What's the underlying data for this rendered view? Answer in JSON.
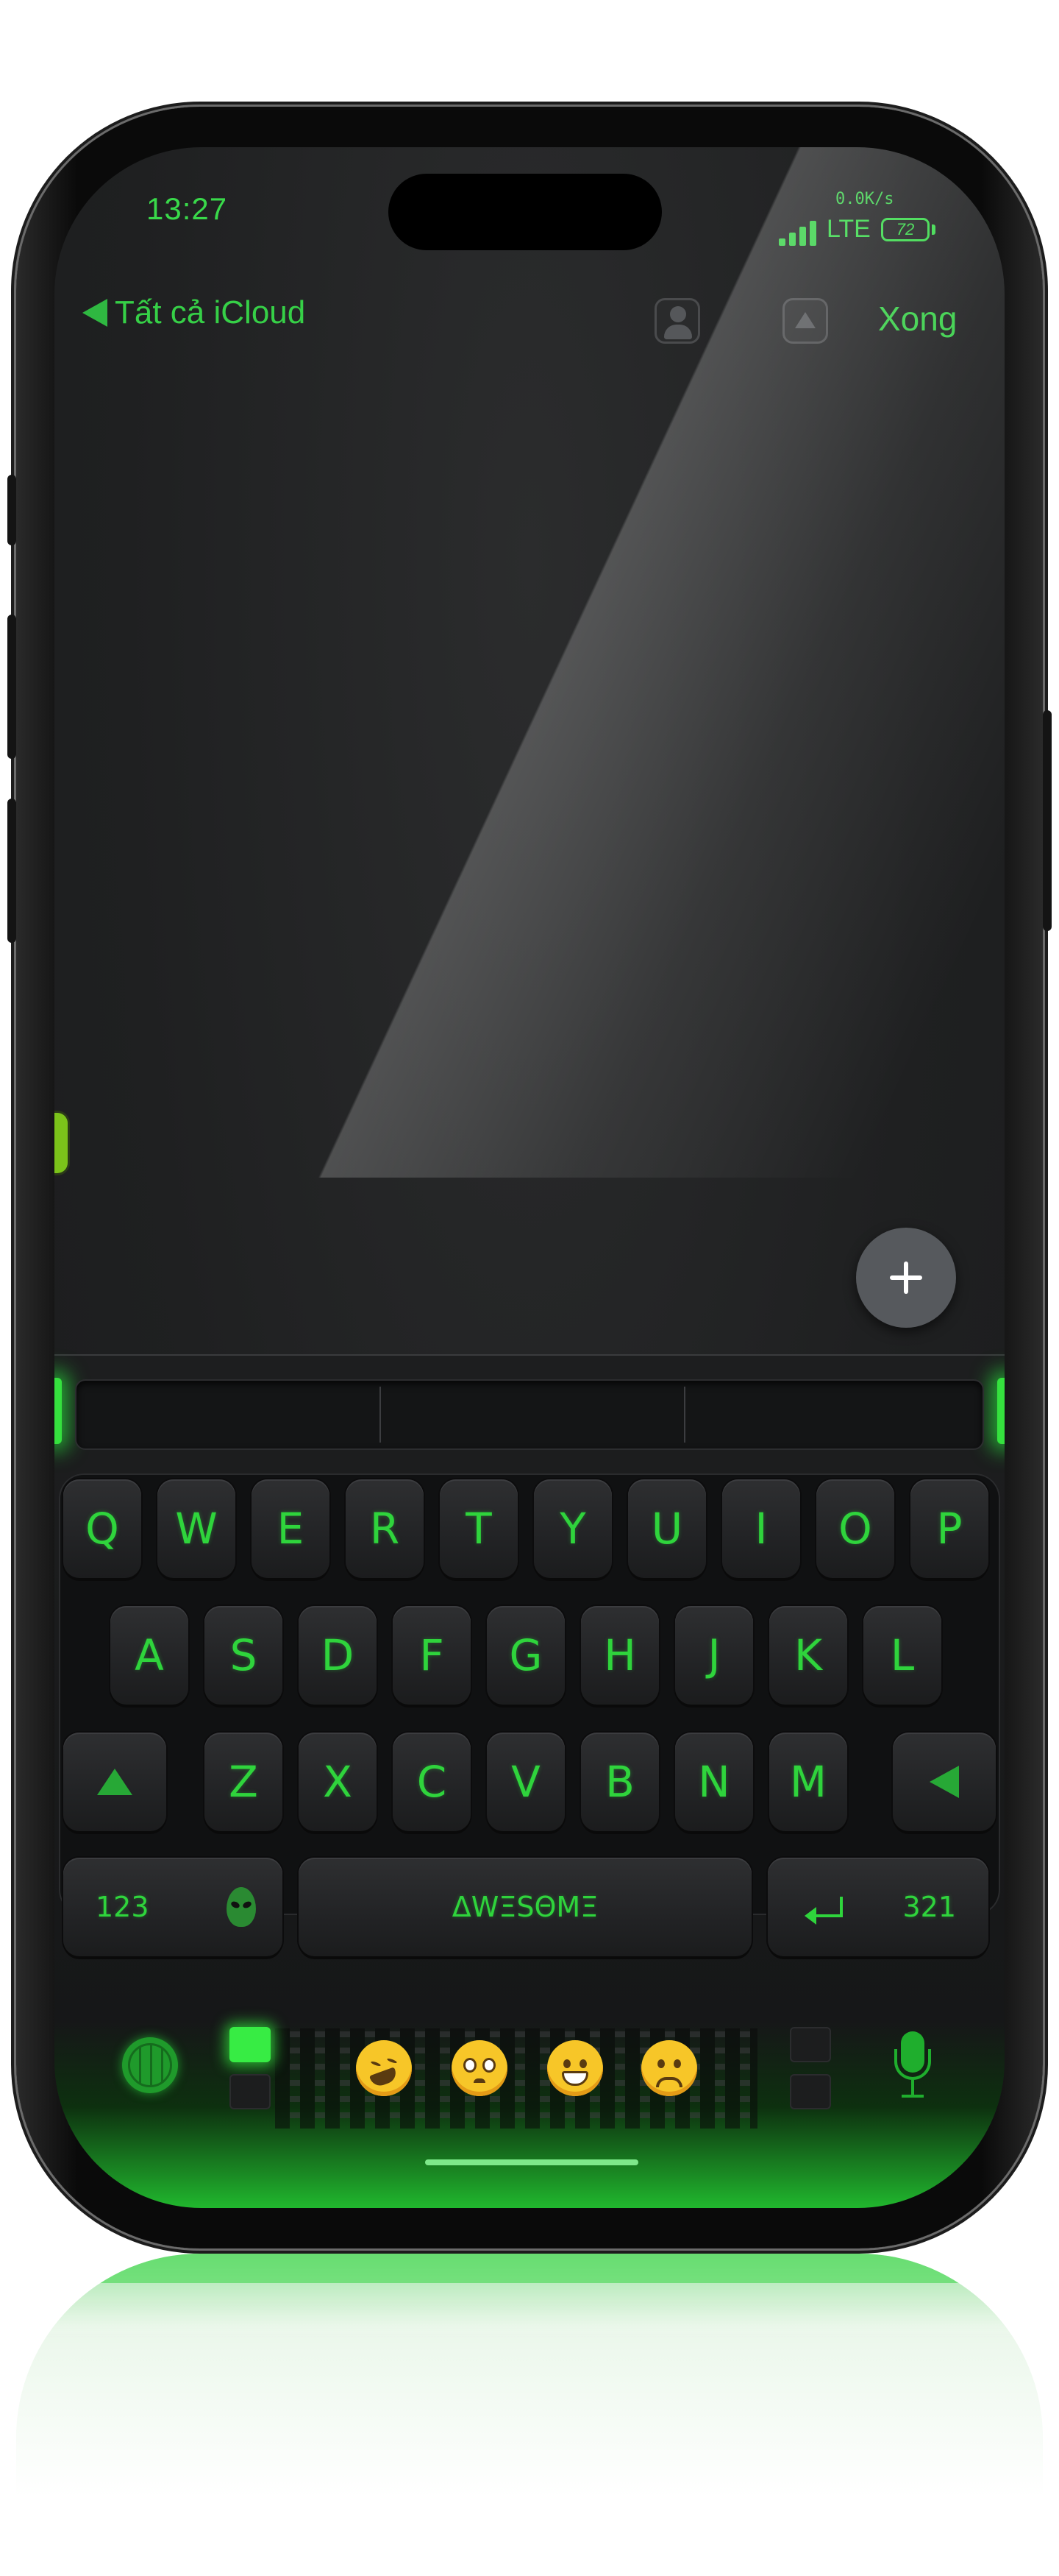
{
  "status_bar": {
    "time": "13:27",
    "net_speed": "0.0K/s",
    "network": "LTE",
    "battery": "72"
  },
  "nav": {
    "back_label": "Tất cả iCloud",
    "done_label": "Xong"
  },
  "keyboard": {
    "row1": [
      "Q",
      "W",
      "E",
      "R",
      "T",
      "Y",
      "U",
      "I",
      "O",
      "P"
    ],
    "row2": [
      "A",
      "S",
      "D",
      "F",
      "G",
      "H",
      "J",
      "K",
      "L"
    ],
    "row3": [
      "Z",
      "X",
      "C",
      "V",
      "B",
      "N",
      "M"
    ],
    "numbers_label": "123",
    "space_label": "ΔWΞSΘMΞ",
    "reverse_numbers_label": "321"
  },
  "emoji_bar": [
    "rofl-emoji",
    "pleading-emoji",
    "grinning-emoji",
    "frowning-emoji"
  ],
  "colors": {
    "accent": "#39d94a",
    "background": "#1f2021",
    "key": "#27282a"
  }
}
